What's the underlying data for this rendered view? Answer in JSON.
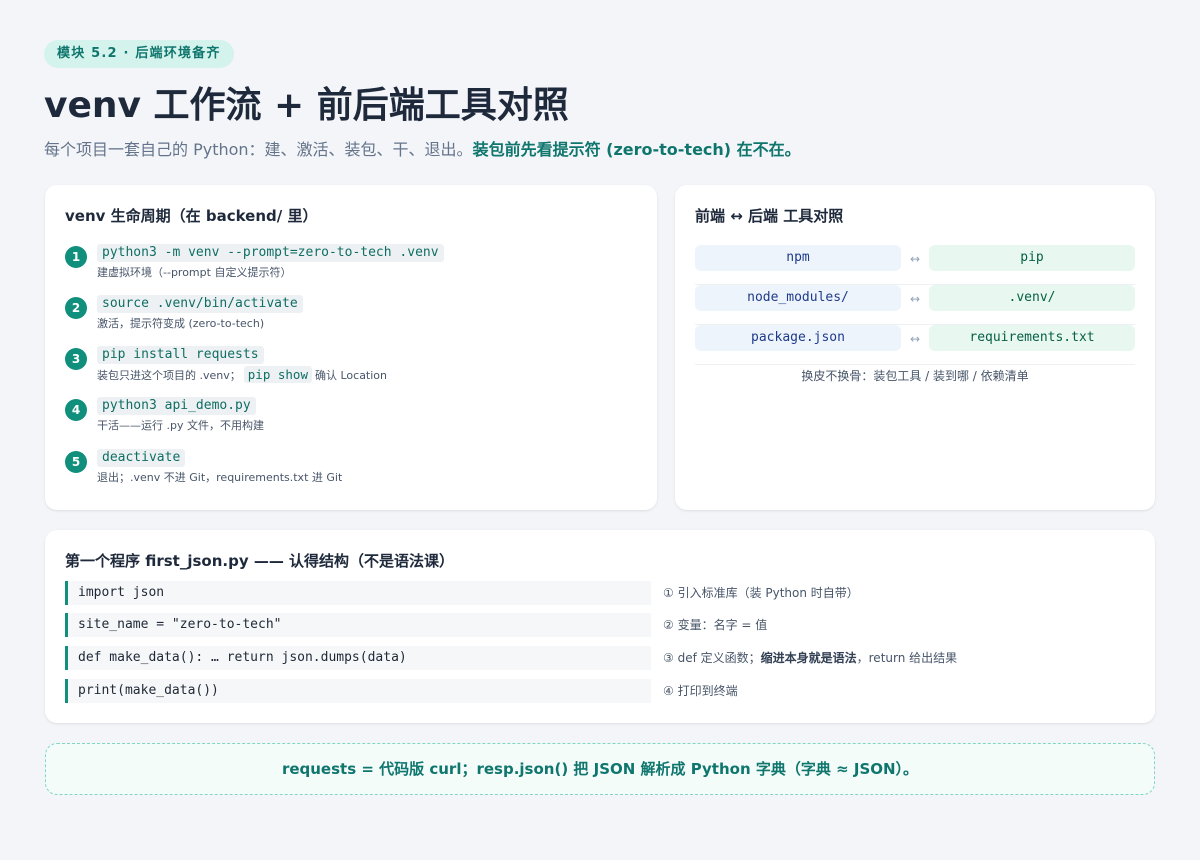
{
  "badge": "模块 5.2 · 后端环境备齐",
  "title": "venv 工作流 + 前后端工具对照",
  "subtitle": {
    "plain": "每个项目一套自己的 Python：建、激活、装包、干、退出。",
    "highlight": "装包前先看提示符 (zero-to-tech) 在不在。"
  },
  "lifecycle": {
    "title": "venv 生命周期（在 backend/ 里）",
    "steps": [
      {
        "num": "1",
        "cmd": "python3 -m venv --prompt=zero-to-tech .venv",
        "desc": "建虚拟环境（--prompt 自定义提示符）"
      },
      {
        "num": "2",
        "cmd": "source .venv/bin/activate",
        "desc": "激活，提示符变成 (zero-to-tech)"
      },
      {
        "num": "3",
        "cmd": "pip install requests",
        "desc": "装包只进这个项目的 .venv；",
        "desc_code": "pip show",
        "desc_after": "确认 Location"
      },
      {
        "num": "4",
        "cmd": "python3 api_demo.py",
        "desc": "干活——运行 .py 文件，不用构建"
      },
      {
        "num": "5",
        "cmd": "deactivate",
        "desc": "退出；.venv 不进 Git，requirements.txt 进 Git"
      }
    ]
  },
  "tools": {
    "title": "前端 ↔ 后端 工具对照",
    "arrow": "↔",
    "rows": [
      {
        "front": "npm",
        "back": "pip"
      },
      {
        "front": "node_modules/",
        "back": ".venv/"
      },
      {
        "front": "package.json",
        "back": "requirements.txt"
      }
    ],
    "note": "换皮不换骨：装包工具 / 装到哪 / 依赖清单"
  },
  "program": {
    "title": "第一个程序 first_json.py —— 认得结构（不是语法课）",
    "lines": [
      {
        "code": "import json",
        "note": "① 引入标准库（装 Python 时自带）"
      },
      {
        "code": "site_name = \"zero-to-tech\"",
        "note": "② 变量：名字 = 值"
      },
      {
        "code": "def make_data(): … return json.dumps(data)",
        "note_pre": "③ def 定义函数；",
        "note_bold": "缩进本身就是语法",
        "note_post": "，return 给出结果"
      },
      {
        "code": "print(make_data())",
        "note": "④ 打印到终端"
      }
    ]
  },
  "footer": "requests = 代码版 curl；resp.json() 把 JSON 解析成 Python 字典（字典 ≈ JSON）。",
  "colors": {
    "accent": "#0f8f7c",
    "accent_text": "#0f766e",
    "badge_bg": "#d4f3ec",
    "front_bg": "#eef4fc",
    "back_bg": "#e8f8f0"
  }
}
